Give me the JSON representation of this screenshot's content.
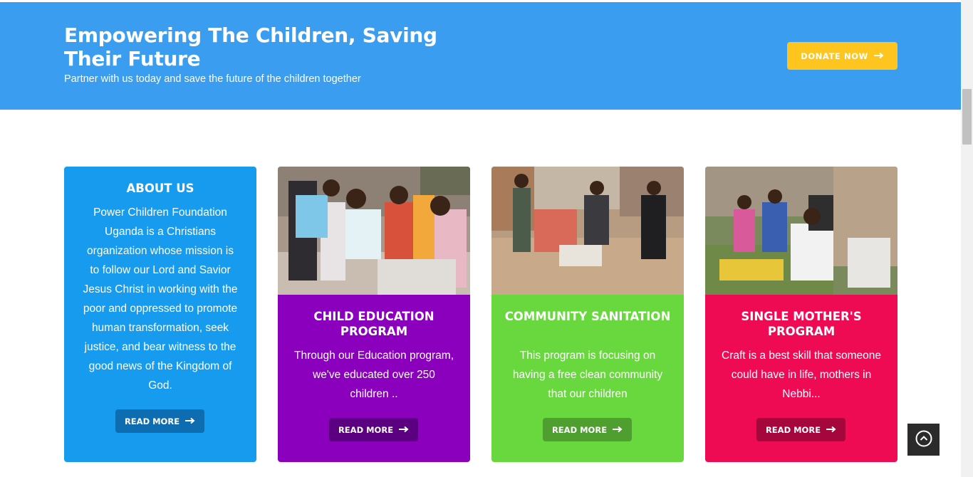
{
  "banner": {
    "title": "Empowering The Children, Saving Their Future",
    "subtitle": "Partner with us today and save the future of the children together",
    "donate_label": "DONATE NOW",
    "bg_color": "#3a9df0",
    "donate_color": "#fdc51e"
  },
  "cards": {
    "about": {
      "title": "ABOUT US",
      "text": "Power Children Foundation Uganda is a Christians organization whose mission is to follow our Lord and Savior Jesus Christ in working with the poor and oppressed to promote human transformation, seek justice, and bear witness to the good news of the Kingdom of God.",
      "button": "READ MORE",
      "color": "#179bee"
    },
    "education": {
      "title": "CHILD EDUCATION PROGRAM",
      "text": "Through our Education program, we've educated over 250 children ..",
      "button": "READ MORE",
      "color": "#8a00bd"
    },
    "sanitation": {
      "title": "COMMUNITY SANITATION",
      "text": "This program is focusing on having a free clean community that our children",
      "button": "READ MORE",
      "color": "#69d83f"
    },
    "mothers": {
      "title": "SINGLE MOTHER'S PROGRAM",
      "text": "Craft is a best skill that someone could have in life, mothers in Nebbi...",
      "button": "READ MORE",
      "color": "#ef0a54"
    }
  },
  "icons": {
    "arrow": "arrow-right-icon",
    "back_to_top": "chevron-up-circle-icon"
  }
}
